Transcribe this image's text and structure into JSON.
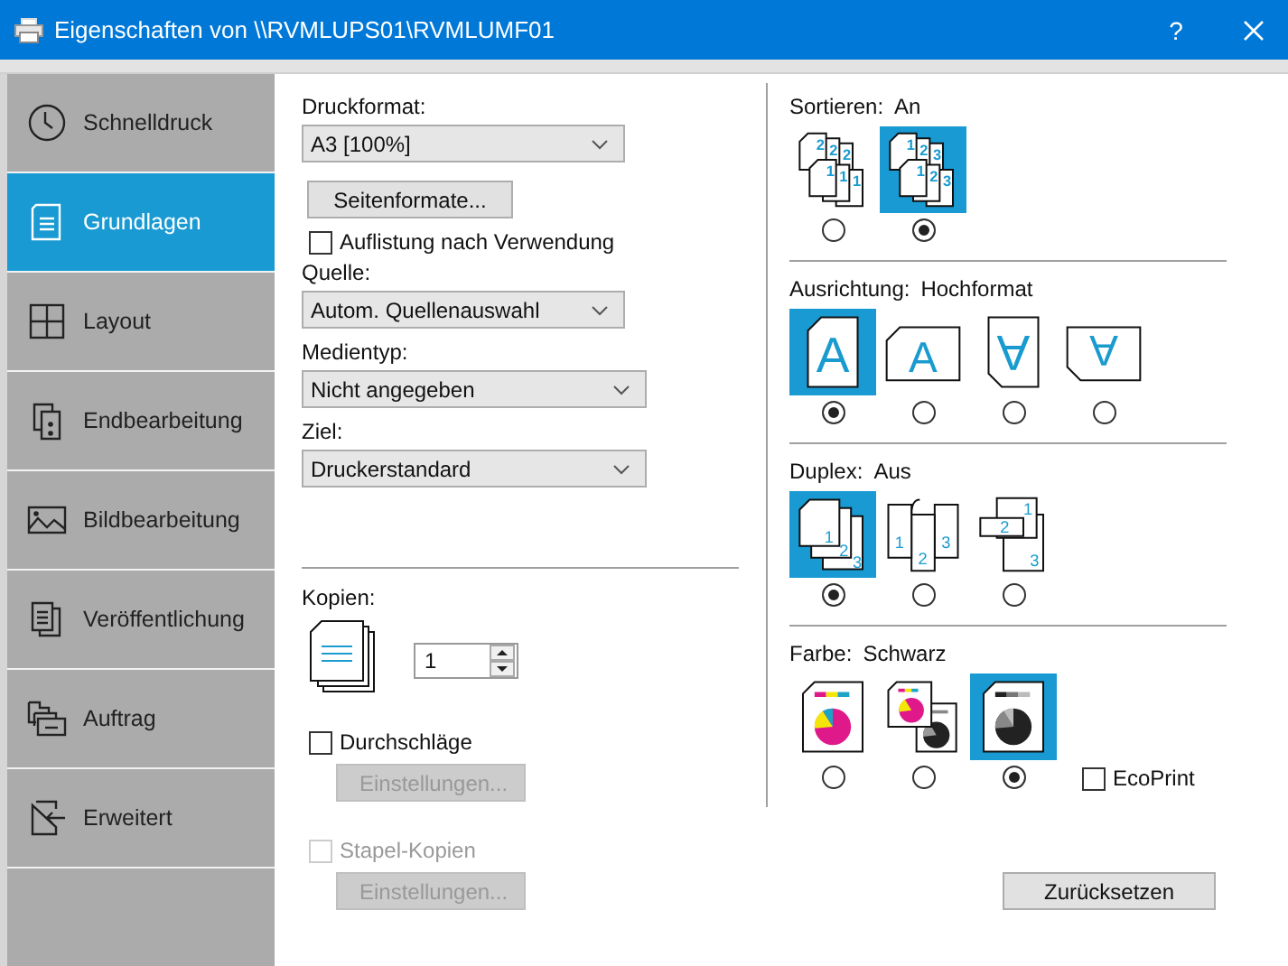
{
  "window": {
    "title": "Eigenschaften von \\\\RVMLUPS01\\RVMLUMF01",
    "help": "?"
  },
  "sidebar": {
    "items": [
      {
        "label": "Schnelldruck",
        "selected": false
      },
      {
        "label": "Grundlagen",
        "selected": true
      },
      {
        "label": "Layout",
        "selected": false
      },
      {
        "label": "Endbearbeitung",
        "selected": false
      },
      {
        "label": "Bildbearbeitung",
        "selected": false
      },
      {
        "label": "Veröffentlichung",
        "selected": false
      },
      {
        "label": "Auftrag",
        "selected": false
      },
      {
        "label": "Erweitert",
        "selected": false
      }
    ]
  },
  "print_size": {
    "label": "Druckformat:",
    "value": "A3  [100%]"
  },
  "page_formats_button": "Seitenformate...",
  "list_by_usage": {
    "label": "Auflistung nach Verwendung",
    "checked": false,
    "disabled": false
  },
  "source": {
    "label": "Quelle:",
    "value": "Autom. Quellenauswahl"
  },
  "media_type": {
    "label": "Medientyp:",
    "value": "Nicht angegeben"
  },
  "destination": {
    "label": "Ziel:",
    "value": "Druckerstandard"
  },
  "copies": {
    "label": "Kopien:",
    "value": "1"
  },
  "carbon_copies": {
    "label": "Durchschläge",
    "checked": false,
    "disabled": false,
    "button": {
      "label": "Einstellungen...",
      "disabled": true
    }
  },
  "stack_copies": {
    "label": "Stapel-Kopien",
    "checked": false,
    "disabled": true,
    "button": {
      "label": "Einstellungen...",
      "disabled": true
    }
  },
  "sections": [
    {
      "label": "Sortieren:",
      "value": "An",
      "options": [
        {
          "marks": [
            "2",
            "2",
            "2",
            "1",
            "1",
            "1"
          ],
          "selected": false
        },
        {
          "marks": [
            "1",
            "2",
            "3",
            "1",
            "2",
            "3"
          ],
          "selected": true
        }
      ]
    },
    {
      "label": "Ausrichtung:",
      "value": "Hochformat",
      "options": [
        {
          "glyph": "A",
          "selected": true
        },
        {
          "glyph": "A",
          "selected": false
        },
        {
          "glyph": "A",
          "selected": false
        },
        {
          "glyph": "A",
          "selected": false
        }
      ]
    },
    {
      "label": "Duplex:",
      "value": "Aus",
      "options": [
        {
          "marks": [
            "1",
            "2",
            "3"
          ],
          "selected": true
        },
        {
          "marks": [
            "1",
            "2",
            "3"
          ],
          "selected": false
        },
        {
          "marks": [
            "1",
            "2",
            "3"
          ],
          "selected": false
        }
      ]
    },
    {
      "label": "Farbe:",
      "value": "Schwarz",
      "options": [
        {
          "selected": false
        },
        {
          "selected": false
        },
        {
          "selected": true
        }
      ],
      "checkbox": {
        "label": "EcoPrint",
        "checked": false,
        "disabled": false
      }
    }
  ],
  "reset_button": "Zurücksetzen"
}
